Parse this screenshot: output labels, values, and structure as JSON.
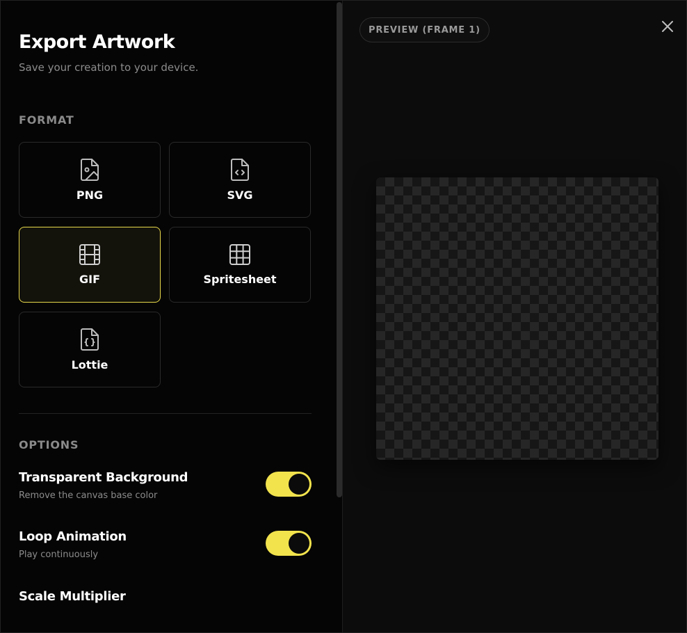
{
  "header": {
    "title": "Export Artwork",
    "subtitle": "Save your creation to your device."
  },
  "format": {
    "label": "FORMAT",
    "selected": "GIF",
    "options": [
      {
        "label": "PNG",
        "icon": "image-file-icon"
      },
      {
        "label": "SVG",
        "icon": "code-file-icon"
      },
      {
        "label": "GIF",
        "icon": "film-icon"
      },
      {
        "label": "Spritesheet",
        "icon": "grid-icon"
      },
      {
        "label": "Lottie",
        "icon": "json-file-icon"
      }
    ]
  },
  "options": {
    "label": "OPTIONS",
    "transparent_background": {
      "title": "Transparent Background",
      "description": "Remove the canvas base color",
      "enabled": true
    },
    "loop_animation": {
      "title": "Loop Animation",
      "description": "Play continuously",
      "enabled": true
    },
    "scale_multiplier": {
      "title": "Scale Multiplier"
    }
  },
  "preview": {
    "badge": "PREVIEW (FRAME 1)"
  },
  "colors": {
    "accent": "#f2e34d",
    "selected_border": "#e9d94b",
    "background": "#050505"
  }
}
